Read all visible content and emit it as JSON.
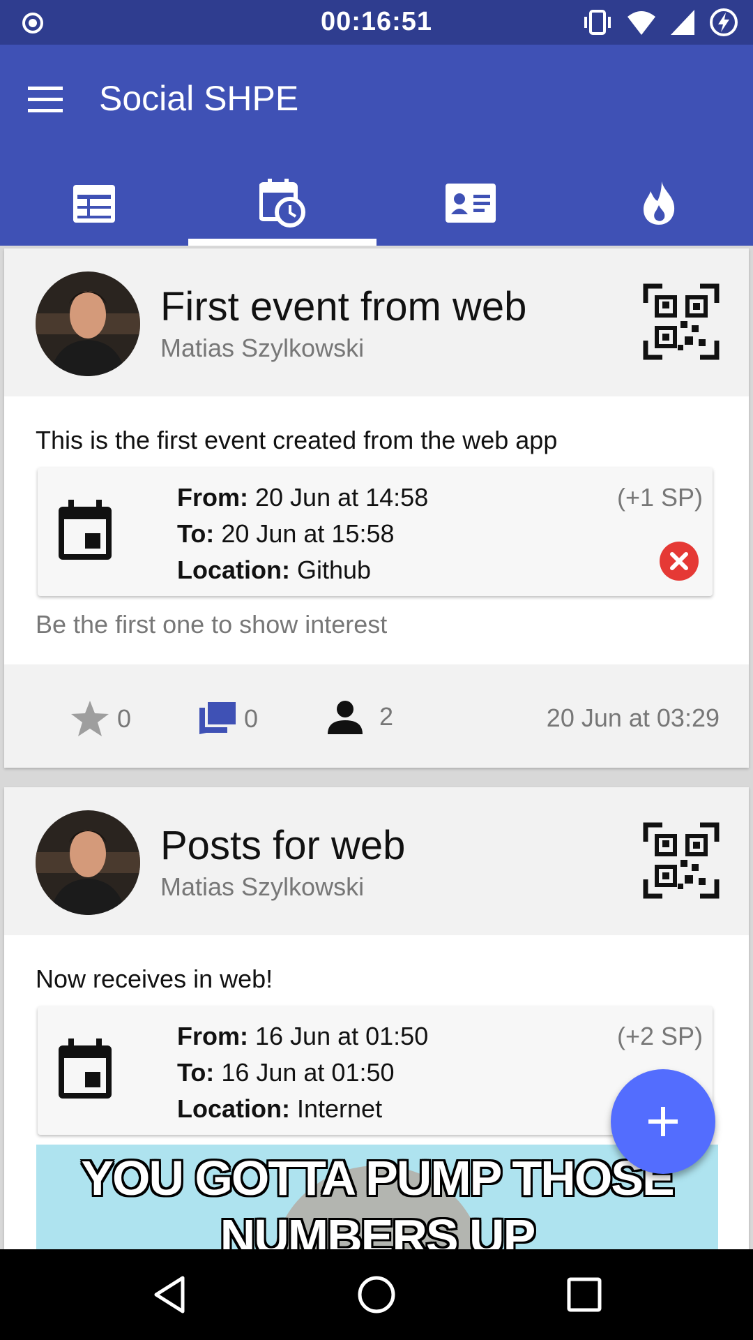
{
  "status_bar": {
    "time": "00:16:51"
  },
  "app_bar": {
    "title": "Social SHPE"
  },
  "tabs": [
    {
      "icon": "calendar-grid-icon",
      "active": false
    },
    {
      "icon": "calendar-clock-icon",
      "active": true
    },
    {
      "icon": "id-card-icon",
      "active": false
    },
    {
      "icon": "flame-icon",
      "active": false
    }
  ],
  "events": [
    {
      "title": "First event from web",
      "author": "Matias Szylkowski",
      "description": "This is the first event created from the web app",
      "from_label": "From:",
      "from": "20 Jun at 14:58",
      "to_label": "To:",
      "to": "20 Jun at 15:58",
      "location_label": "Location:",
      "location": "Github",
      "sp": "(+1 SP)",
      "interest": "Be the first one to show interest",
      "stars": "0",
      "comments": "0",
      "attendees": "2",
      "date": "20 Jun at 03:29"
    },
    {
      "title": "Posts for web",
      "author": "Matias Szylkowski",
      "description": "Now receives in web!",
      "from_label": "From:",
      "from": "16 Jun at 01:50",
      "to_label": "To:",
      "to": "16 Jun at 01:50",
      "location_label": "Location:",
      "location": "Internet",
      "sp": "(+2 SP)",
      "meme_line1": "YOU GOTTA PUMP THOSE",
      "meme_line2": "NUMBERS UP"
    }
  ],
  "colors": {
    "primary": "#3f51b5",
    "status_bar": "#2f3d8f",
    "accent": "#536dfe",
    "cancel": "#e53935"
  }
}
